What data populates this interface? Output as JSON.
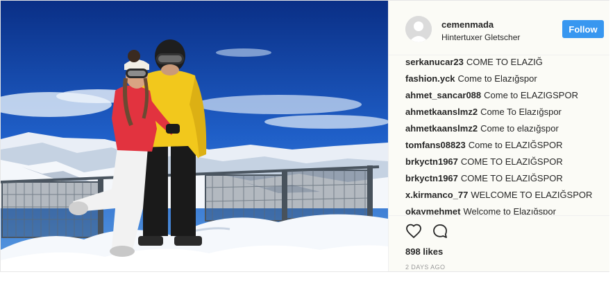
{
  "post": {
    "username": "cemenmada",
    "location": "Hintertuxer Gletscher",
    "follow_label": "Follow",
    "comments": [
      {
        "user": "serkanucar23",
        "text": "COME TO ELAZIĞ"
      },
      {
        "user": "fashion.yck",
        "text": "Come to Elazığspor"
      },
      {
        "user": "ahmet_sancar088",
        "text": "Come to ELAZIGSPOR"
      },
      {
        "user": "ahmetkaanslmz2",
        "text": "Come To Elazığspor"
      },
      {
        "user": "ahmetkaanslmz2",
        "text": "Come to elazığspor"
      },
      {
        "user": "tomfans08823",
        "text": "Come to ELAZIĞSPOR"
      },
      {
        "user": "brkyctn1967",
        "text": "COME TO ELAZIĞSPOR"
      },
      {
        "user": "brkyctn1967",
        "text": "COME TO ELAZIĞSPOR"
      },
      {
        "user": "x.kirmanco_77",
        "text": "WELCOME TO ELAZIĞSPOR"
      },
      {
        "user": "okaymehmet",
        "text": "Welcome to Elazığspor"
      }
    ],
    "likes": "898 likes",
    "time": "2 DAYS AGO"
  },
  "icons": {
    "like": "heart-icon",
    "comment": "speech-bubble-icon",
    "avatar": "default-avatar"
  },
  "colors": {
    "follow": "#3897f0",
    "text": "#262626",
    "muted": "#999999"
  }
}
